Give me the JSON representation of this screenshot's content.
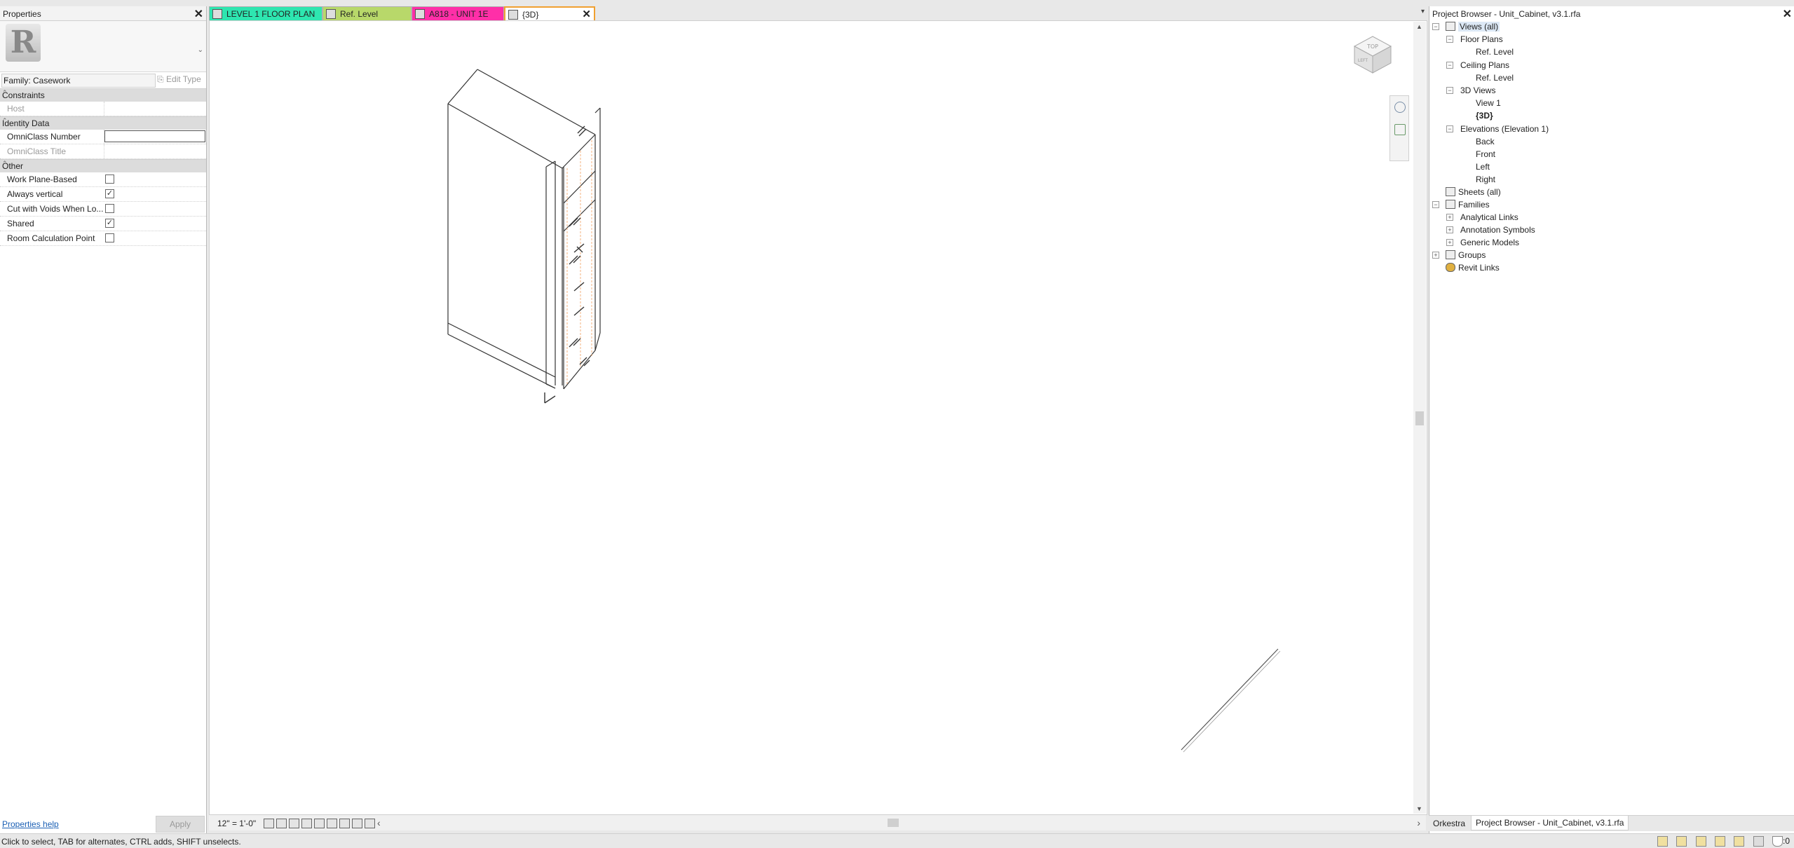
{
  "properties": {
    "title": "Properties",
    "family": "Family: Casework",
    "edit_type": "Edit Type",
    "sections": {
      "constraints": "Constraints",
      "identity": "Identity Data",
      "other": "Other"
    },
    "rows": {
      "host": "Host",
      "omniclass_number": "OmniClass Number",
      "omniclass_title": "OmniClass Title",
      "work_plane_based": "Work Plane-Based",
      "always_vertical": "Always vertical",
      "cut_with_voids": "Cut with Voids When Lo...",
      "shared": "Shared",
      "room_calc": "Room Calculation Point"
    },
    "checks": {
      "work_plane_based": false,
      "always_vertical": true,
      "cut_with_voids": false,
      "shared": true,
      "room_calc": false
    },
    "help": "Properties help",
    "apply": "Apply"
  },
  "tabs": [
    {
      "label": "LEVEL 1 FLOOR PLAN",
      "color": "#2ee6b0"
    },
    {
      "label": "Ref. Level",
      "color": "#b8d86a"
    },
    {
      "label": "A818 - UNIT 1E",
      "color": "#ff2fa8"
    },
    {
      "label": "{3D}",
      "color": "#ffffff",
      "active": true
    }
  ],
  "viewcube": {
    "top": "TOP",
    "face": "LEFT"
  },
  "view_control": {
    "scale": "12\" = 1'-0\""
  },
  "project_browser": {
    "title": "Project Browser - Unit_Cabinet, v3.1.rfa",
    "items": {
      "views_all": "Views (all)",
      "floor_plans": "Floor Plans",
      "fp_ref": "Ref. Level",
      "ceiling_plans": "Ceiling Plans",
      "cp_ref": "Ref. Level",
      "views3d": "3D Views",
      "view1": "View 1",
      "view3d": "{3D}",
      "elevations": "Elevations (Elevation 1)",
      "back": "Back",
      "front": "Front",
      "left": "Left",
      "right": "Right",
      "sheets": "Sheets (all)",
      "families": "Families",
      "analytical": "Analytical Links",
      "annotation": "Annotation Symbols",
      "generic": "Generic Models",
      "groups": "Groups",
      "revit_links": "Revit Links"
    },
    "bottom_tabs": [
      "Orkestra",
      "Project Browser - Unit_Cabinet, v3.1.rfa"
    ]
  },
  "status": {
    "text": "Click to select, TAB for alternates, CTRL adds, SHIFT unselects.",
    "filter_count": ":0"
  }
}
